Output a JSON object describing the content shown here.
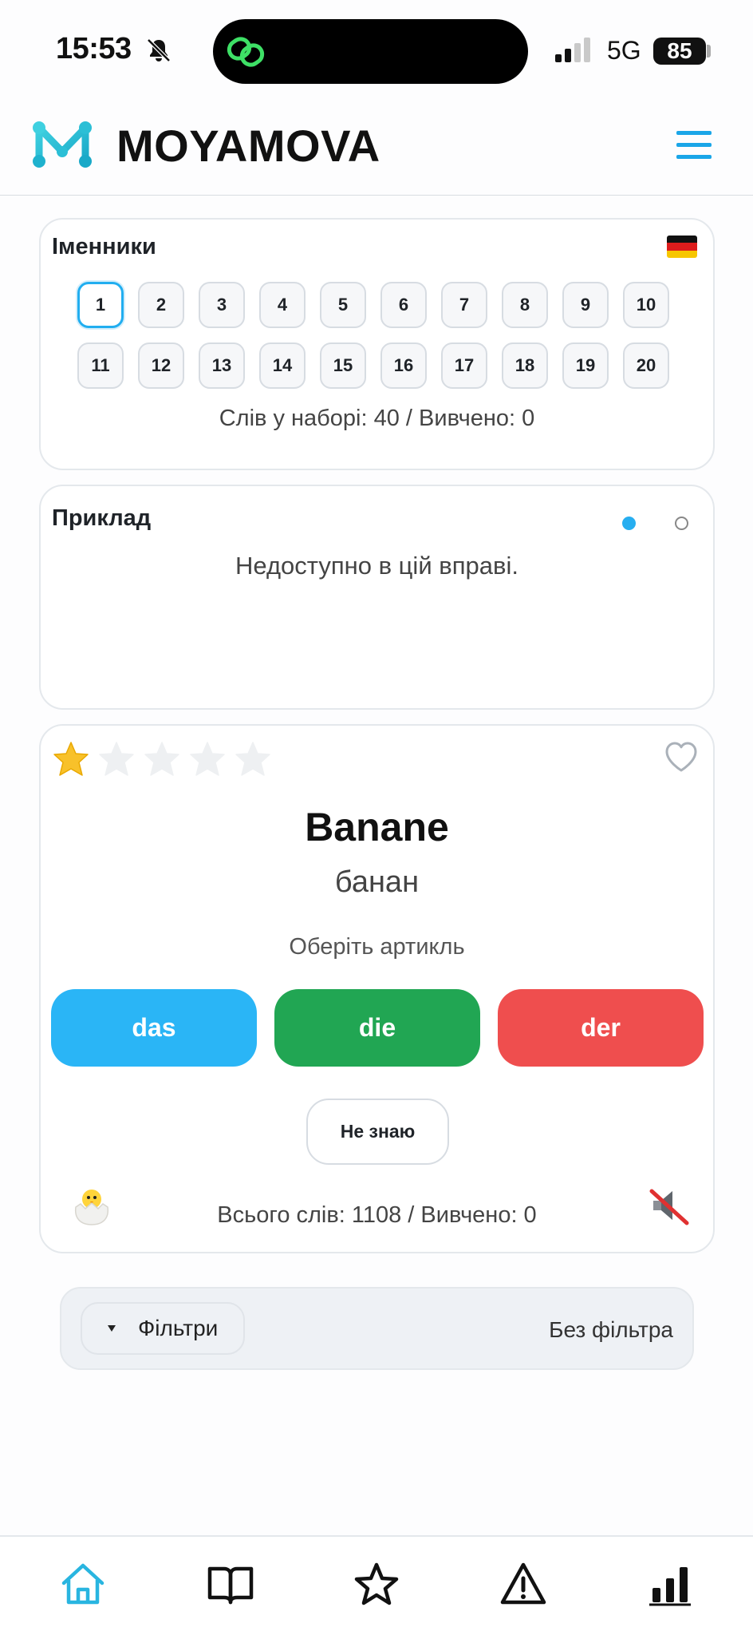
{
  "status_bar": {
    "time": "15:53",
    "network": "5G",
    "battery": "85"
  },
  "header": {
    "logo_text": "MOYAMOVA",
    "accent": "#1aa6e8"
  },
  "sets_card": {
    "title": "Іменники",
    "language_flag": "germany-flag",
    "sets": [
      "1",
      "2",
      "3",
      "4",
      "5",
      "6",
      "7",
      "8",
      "9",
      "10",
      "11",
      "12",
      "13",
      "14",
      "15",
      "16",
      "17",
      "18",
      "19",
      "20"
    ],
    "active_set": "1",
    "summary": "Слів у наборі: 40 / Вивчено: 0"
  },
  "example_card": {
    "title": "Приклад",
    "message": "Недоступно в цій вправі."
  },
  "trainer_card": {
    "rating": 1,
    "rating_max": 5,
    "word": "Banane",
    "translation": "банан",
    "prompt": "Оберіть артикль",
    "articles": [
      {
        "label": "das",
        "color": "#2ab5f6"
      },
      {
        "label": "die",
        "color": "#21a653"
      },
      {
        "label": "der",
        "color": "#ef4e4e"
      }
    ],
    "dont_know_label": "Не знаю",
    "totals": "Всього слів: 1108 / Вивчено: 0"
  },
  "filters": {
    "label": "Фільтри",
    "value": "Без фільтра"
  },
  "bottom_nav": {
    "items": [
      "home-icon",
      "book-icon",
      "star-icon",
      "warning-icon",
      "stats-icon"
    ],
    "active": "home-icon"
  }
}
